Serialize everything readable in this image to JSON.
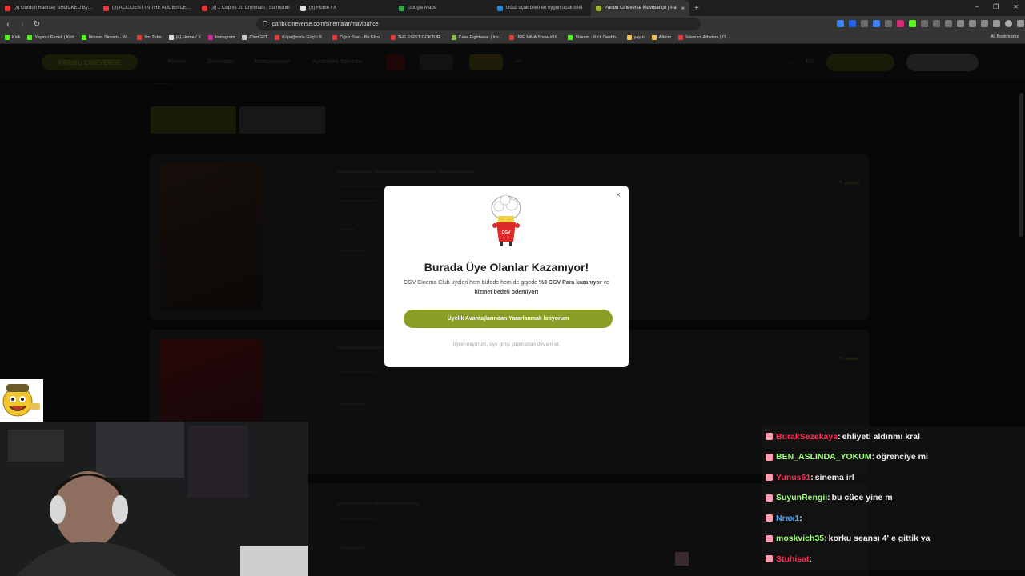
{
  "browser": {
    "tabs": [
      {
        "label": "(3) Gordon Ramsay SHOCKED By Th",
        "icon": "youtube-icon",
        "color": "#e53935"
      },
      {
        "label": "(3) ACCIDENT IN THE AUDIENCE STA",
        "icon": "youtube-icon",
        "color": "#e53935"
      },
      {
        "label": "(3) 1 Cop vs 20 Criminals | Surroundi",
        "icon": "youtube-icon",
        "color": "#e53935"
      },
      {
        "label": "(5) Home / X",
        "icon": "x-icon",
        "color": "#dddddd"
      },
      {
        "label": "Google Maps",
        "icon": "maps-icon",
        "color": "#34a853"
      },
      {
        "label": "Ucuz uçak bileti en uygun uçak bilet",
        "icon": "plane-icon",
        "color": "#1e88e5"
      },
      {
        "label": "Paribu Cineverse MaviBahçe | Pa",
        "icon": "paribu-icon",
        "color": "#9cb82a",
        "active": true
      }
    ],
    "new_tab": "+",
    "window_controls": [
      "–",
      "❐",
      "✕"
    ],
    "url": "paribucineverse.com/sinemalar/mavibahce",
    "bookmarks": [
      {
        "label": "Kick",
        "color": "#53fc18"
      },
      {
        "label": "Yayıncı Paneli | Kick",
        "color": "#53fc18"
      },
      {
        "label": "İkinsan Stream - W...",
        "color": "#53fc18"
      },
      {
        "label": "YouTube",
        "color": "#e53935"
      },
      {
        "label": "(4) Home / X",
        "color": "#dddddd"
      },
      {
        "label": "Instagram",
        "color": "#d6249f"
      },
      {
        "label": "ChatGPT",
        "color": "#cccccc"
      },
      {
        "label": "Köpeğinizle Güçlü B...",
        "color": "#e53935"
      },
      {
        "label": "Oğuz Sasi - Bir Efsa...",
        "color": "#e53935"
      },
      {
        "label": "THE FIRST GOKTUR...",
        "color": "#e53935"
      },
      {
        "label": "Cave Fightwear | Ins...",
        "color": "#8bc34a"
      },
      {
        "label": "JRE MMA Show #16...",
        "color": "#e53935"
      },
      {
        "label": "Stream - Kick Dashb...",
        "color": "#53fc18"
      },
      {
        "label": "yayın",
        "color": "#f2c14e"
      },
      {
        "label": "Albüm",
        "color": "#f2c14e"
      },
      {
        "label": "İslam vs Atheism | O...",
        "color": "#e53935"
      }
    ],
    "all_bookmarks": "All Bookmarks"
  },
  "modal": {
    "title": "Burada Üye Olanlar Kazanıyor!",
    "desc_prefix": "CGV Cinema Club üyeleri hem büfede hem de gişede ",
    "desc_bold1": "%3 CGV Para kazanıyor",
    "desc_mid": " ve ",
    "desc_bold2": "hizmet bedeli ödemiyor!",
    "cta": "Üyelik Avantajlarından Yararlanmak İstiyorum",
    "skip": "İlgilenmiyorum, üye girişi yapmadan devam et.",
    "close": "×",
    "accent": "#8a9d24"
  },
  "chat": [
    {
      "user": "BurakSezekaya",
      "sep": ":",
      "msg": "ehliyeti aldınmı kral",
      "color": "#ff2d55"
    },
    {
      "user": "BEN_ASLINDA_YOKUM",
      "sep": ":",
      "msg": "öğrenciye mi",
      "color": "#9eff7a"
    },
    {
      "user": "Yunus61",
      "sep": ":",
      "msg": "sinema irl",
      "color": "#ff2d55"
    },
    {
      "user": "SuyunRengii",
      "sep": ":",
      "msg": "bu cüce yine m",
      "color": "#9eff7a"
    },
    {
      "user": "Nrax1",
      "sep": ":",
      "msg": "",
      "color": "#4aa3ff"
    },
    {
      "user": "moskvich35",
      "sep": ":",
      "msg": "korku seansı 4' e gittik ya",
      "color": "#9eff7a"
    },
    {
      "user": "Stuhisat",
      "sep": ":",
      "msg": "",
      "color": "#ff2d55"
    }
  ]
}
